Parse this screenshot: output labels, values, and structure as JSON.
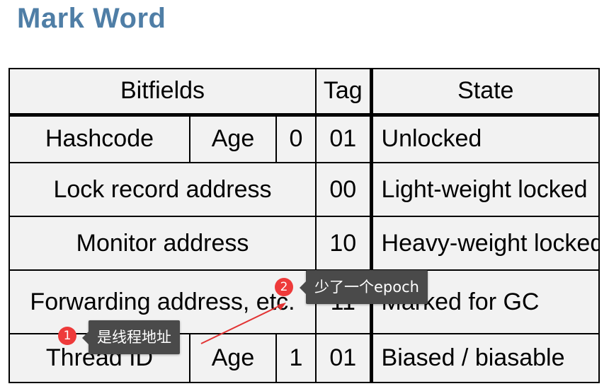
{
  "title": "Mark Word",
  "table": {
    "headers": {
      "bitfields": "Bitfields",
      "tag": "Tag",
      "state": "State"
    },
    "rows": [
      {
        "hashcode": "Hashcode",
        "age": "Age",
        "bit": "0",
        "tag": "01",
        "state": "Unlocked"
      },
      {
        "field": "Lock record address",
        "tag": "00",
        "state": "Light-weight locked"
      },
      {
        "field": "Monitor address",
        "tag": "10",
        "state": "Heavy-weight locked"
      },
      {
        "field": "Forwarding address, etc.",
        "tag": "11",
        "state": "Marked for GC"
      },
      {
        "thread": "Thread ID",
        "age": "Age",
        "bit": "1",
        "tag": "01",
        "state": "Biased / biasable"
      }
    ]
  },
  "annotations": [
    {
      "number": "1",
      "text": "是线程地址"
    },
    {
      "number": "2",
      "text": "少了一个epoch"
    }
  ],
  "colors": {
    "title": "#4f7ea6",
    "badge": "#ee3a3a",
    "tooltip": "#4a4a4a",
    "arrow": "#e23333"
  }
}
